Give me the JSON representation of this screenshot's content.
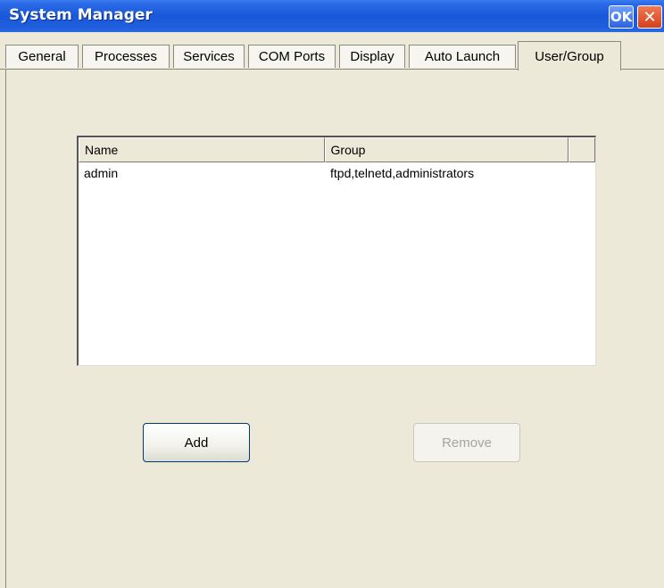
{
  "window": {
    "title": "System Manager",
    "ok_label": "OK",
    "close_label": "✕"
  },
  "tabs": [
    {
      "label": "General"
    },
    {
      "label": "Processes"
    },
    {
      "label": "Services"
    },
    {
      "label": "COM Ports"
    },
    {
      "label": "Display"
    },
    {
      "label": "Auto Launch"
    },
    {
      "label": "User/Group",
      "active": true
    }
  ],
  "list": {
    "columns": [
      "Name",
      "Group",
      ""
    ],
    "rows": [
      {
        "name": "admin",
        "group": "ftpd,telnetd,administrators"
      }
    ]
  },
  "buttons": {
    "add": "Add",
    "remove": "Remove"
  },
  "colors": {
    "titlebar": "#1958d9",
    "face": "#ece9d8",
    "disabled_text": "#a7a69b"
  }
}
